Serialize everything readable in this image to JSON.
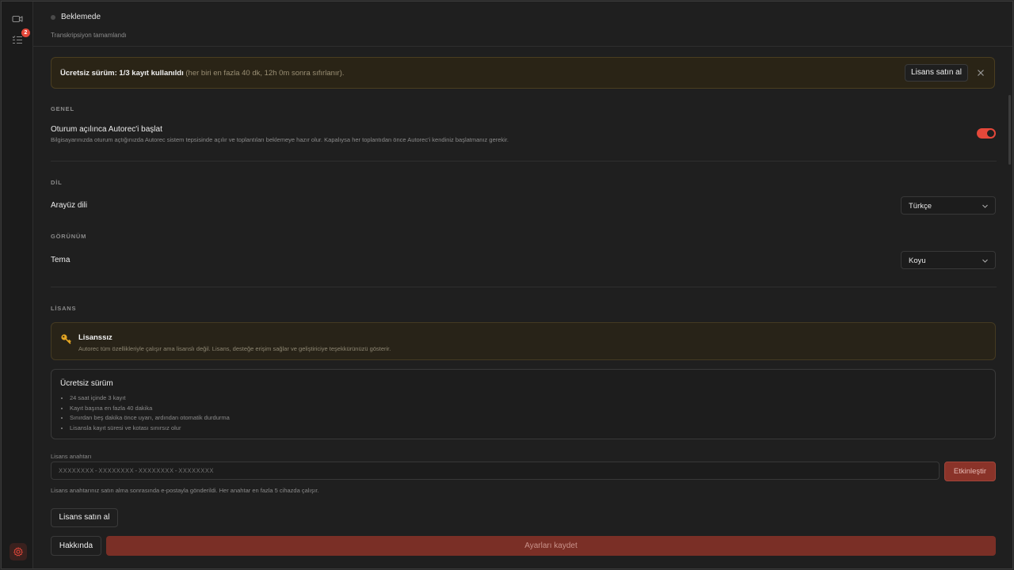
{
  "status": {
    "title": "Beklemede",
    "subtitle": "Transkripsiyon tamamlandı"
  },
  "rail": {
    "badge_count": "2",
    "active_color": "#e5483a"
  },
  "banner": {
    "bold_text": "Ücretsiz sürüm: 1/3 kayıt kullanıldı",
    "muted_text": " (her biri en fazla 40 dk, 12h 0m sonra sıfırlanır).",
    "buy_label": "Lisans satın al"
  },
  "general": {
    "section": "GENEL",
    "autostart_title": "Oturum açılınca Autorec'i başlat",
    "autostart_desc": "Bilgisayarınızda oturum açtığınızda Autorec sistem tepsisinde açılır ve toplantıları beklemeye hazır olur. Kapalıysa her toplantıdan önce Autorec'i kendiniz başlatmanız gerekir.",
    "autostart_on": true
  },
  "language": {
    "section": "DİL",
    "label": "Arayüz dili",
    "value": "Türkçe"
  },
  "appearance": {
    "section": "GÖRÜNÜM",
    "label": "Tema",
    "value": "Koyu"
  },
  "license": {
    "section": "LİSANS",
    "status_title": "Lisanssız",
    "status_desc": "Autorec tüm özellikleriyle çalışır ama lisanslı değil. Lisans, desteğe erişim sağlar ve geliştiriciye teşekkürünüzü gösterir.",
    "free_title": "Ücretsiz sürüm",
    "free_items": [
      "24 saat içinde 3 kayıt",
      "Kayıt başına en fazla 40 dakika",
      "Sınırdan beş dakika önce uyarı, ardından otomatik durdurma",
      "Lisansla kayıt süresi ve kotası sınırsız olur"
    ],
    "key_label": "Lisans anahtarı",
    "key_placeholder": "XXXXXXXX-XXXXXXXX-XXXXXXXX-XXXXXXXX",
    "key_value": "",
    "activate_label": "Etkinleştir",
    "key_help": "Lisans anahtarınız satın alma sonrasında e-postayla gönderildi. Her anahtar en fazla 5 cihazda çalışır.",
    "buy_label": "Lisans satın al"
  },
  "footer": {
    "about_label": "Hakkında",
    "save_label": "Ayarları kaydet"
  },
  "icons": {
    "rail_top": "video-camera-icon",
    "rail_second": "task-list-icon",
    "rail_bottom": "gear-icon",
    "banner_close": "close-icon",
    "license_status": "key-icon",
    "select": "chevron-down-icon"
  }
}
